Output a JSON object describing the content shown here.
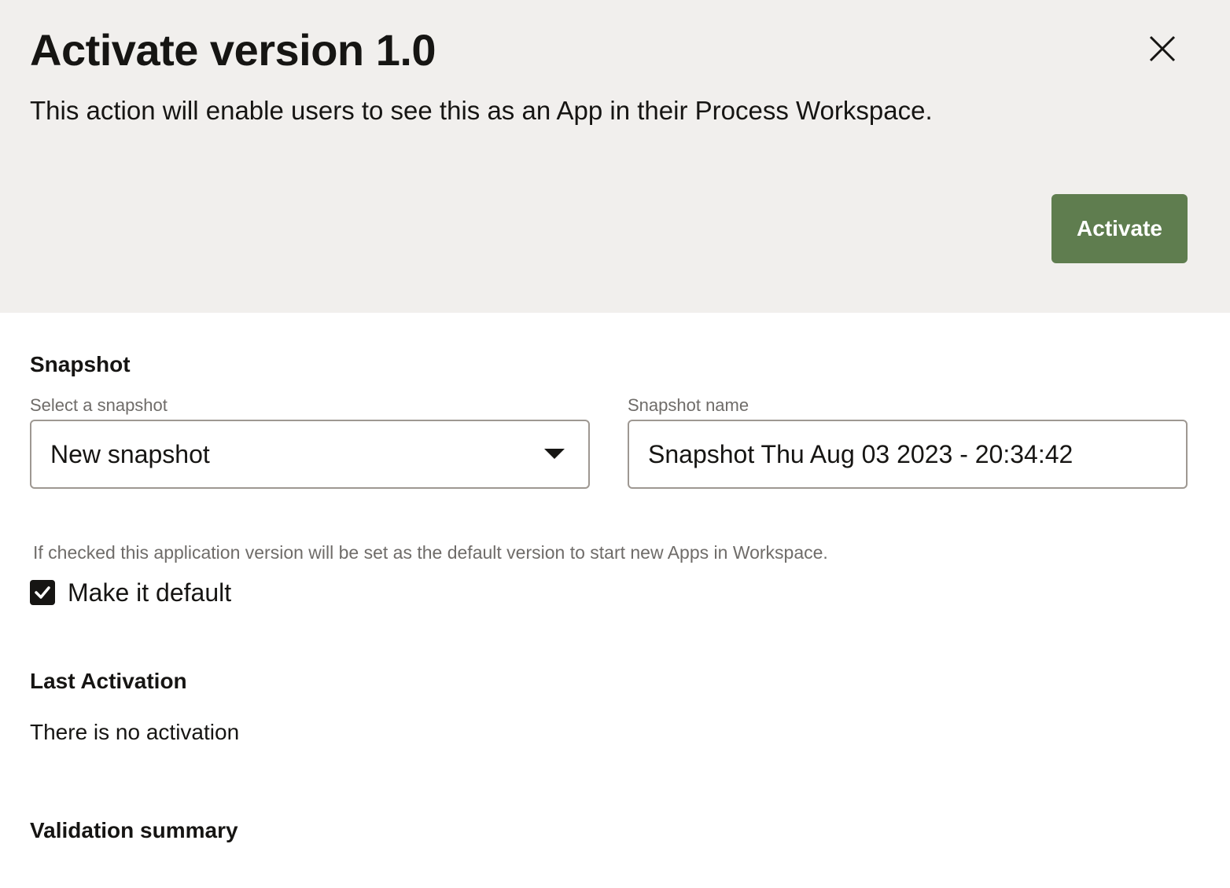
{
  "dialog": {
    "title": "Activate version 1.0",
    "description": "This action will enable users to see this as an App in their Process Workspace.",
    "close_icon": "close-icon",
    "activate_label": "Activate",
    "accent_color": "#5f7d4f"
  },
  "snapshot": {
    "heading": "Snapshot",
    "select_label": "Select a snapshot",
    "select_value": "New snapshot",
    "select_icon": "chevron-down-icon",
    "name_label": "Snapshot name",
    "name_value": "Snapshot Thu Aug 03 2023 - 20:34:42"
  },
  "default_option": {
    "help": "If checked this application version will be set as the default version to start new Apps in Workspace.",
    "label": "Make it default",
    "checked": true
  },
  "last_activation": {
    "heading": "Last Activation",
    "text": "There is no activation"
  },
  "validation": {
    "heading": "Validation summary"
  }
}
